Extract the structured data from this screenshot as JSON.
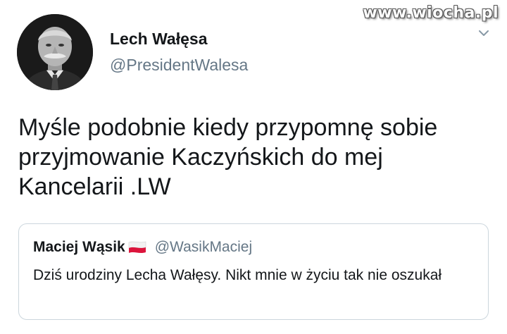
{
  "watermark": {
    "text": "www.wiocha.pl"
  },
  "author": {
    "name": "Lech Wałęsa",
    "handle": "@PresidentWalesa",
    "avatar_icon": "portrait-photo"
  },
  "tweet": {
    "text": "Myśle podobnie kiedy przypomnę sobie przyjmowanie Kaczyńskich do mej Kancelarii .LW"
  },
  "quoted_tweet": {
    "name": "Maciej Wąsik",
    "flag_icon": "poland-flag-emoji",
    "handle": "@WasikMaciej",
    "text": "Dziś urodziny Lecha Wałęsy. Nikt mnie w życiu tak nie oszukał"
  },
  "menu": {
    "icon": "chevron-down-icon"
  },
  "colors": {
    "text_primary": "#14171a",
    "text_secondary": "#657786",
    "border": "#ccd6dd",
    "flag_red": "#dc143c"
  }
}
